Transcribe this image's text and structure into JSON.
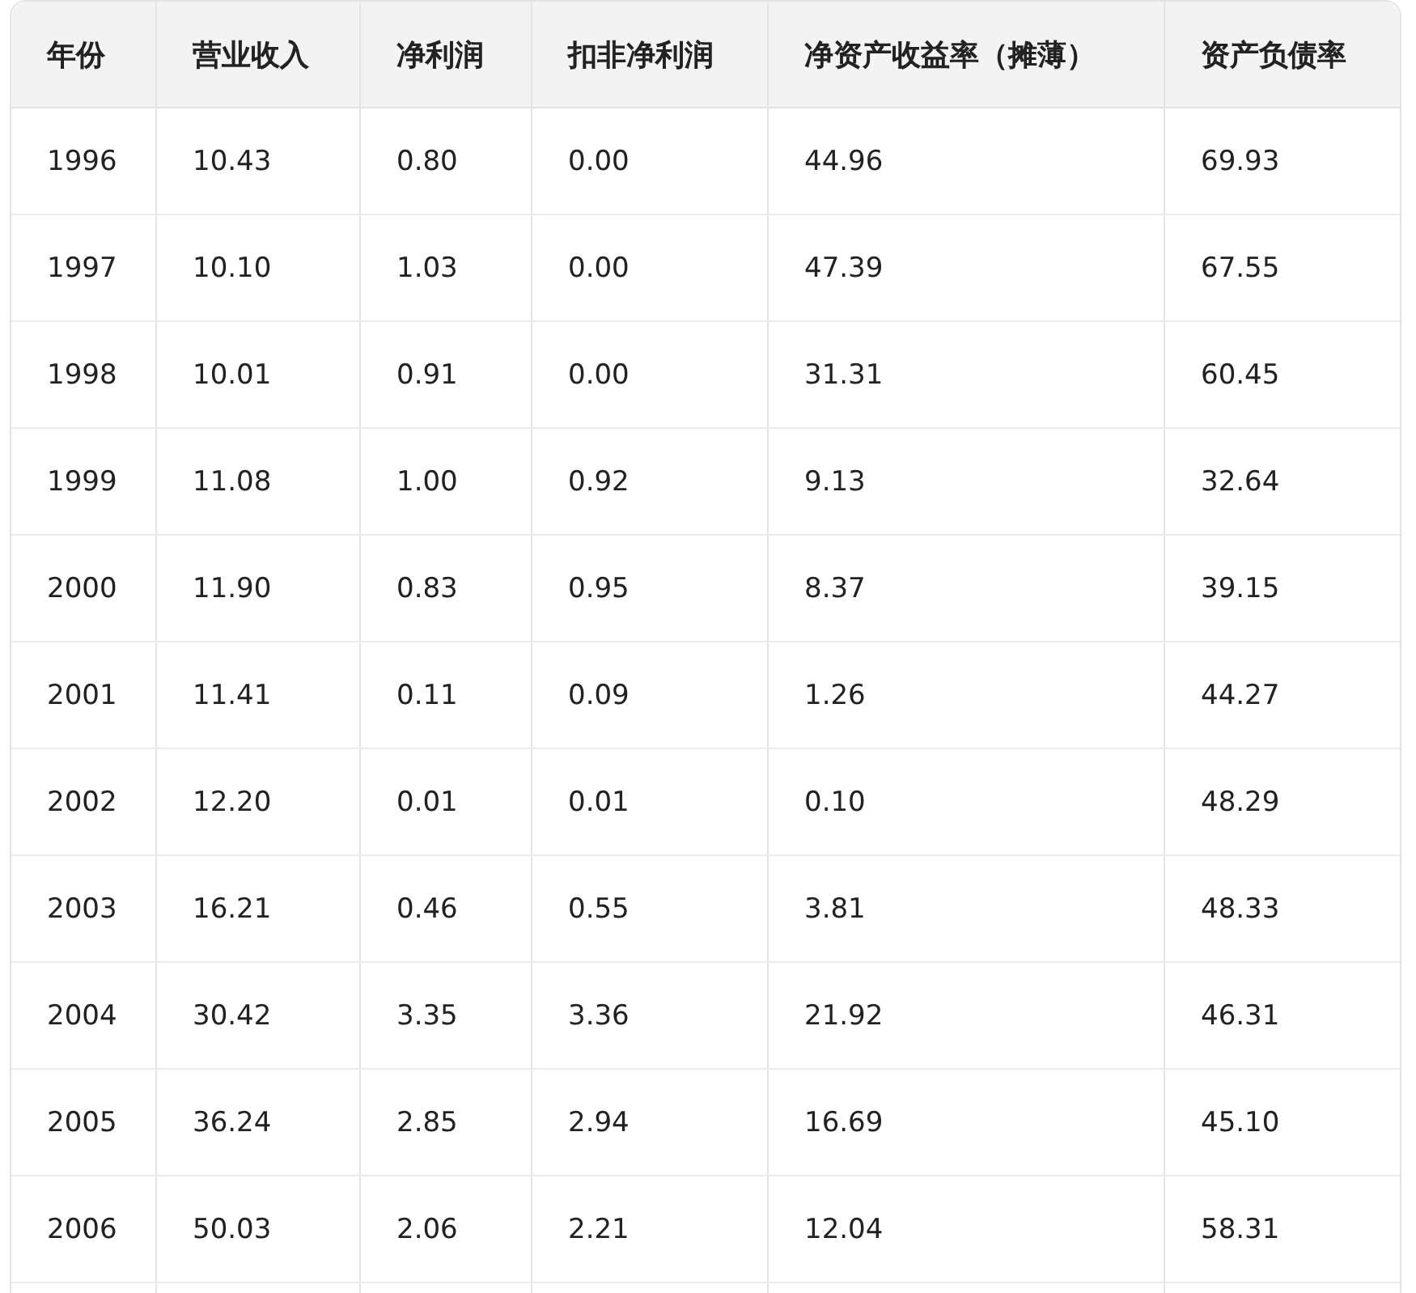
{
  "table": {
    "columns": [
      "年份",
      "营业收入",
      "净利润",
      "扣非净利润",
      "净资产收益率（摊薄）",
      "资产负债率"
    ],
    "rows": [
      [
        "1996",
        "10.43",
        "0.80",
        "0.00",
        "44.96",
        "69.93"
      ],
      [
        "1997",
        "10.10",
        "1.03",
        "0.00",
        "47.39",
        "67.55"
      ],
      [
        "1998",
        "10.01",
        "0.91",
        "0.00",
        "31.31",
        "60.45"
      ],
      [
        "1999",
        "11.08",
        "1.00",
        "0.92",
        "9.13",
        "32.64"
      ],
      [
        "2000",
        "11.90",
        "0.83",
        "0.95",
        "8.37",
        "39.15"
      ],
      [
        "2001",
        "11.41",
        "0.11",
        "0.09",
        "1.26",
        "44.27"
      ],
      [
        "2002",
        "12.20",
        "0.01",
        "0.01",
        "0.10",
        "48.29"
      ],
      [
        "2003",
        "16.21",
        "0.46",
        "0.55",
        "3.81",
        "48.33"
      ],
      [
        "2004",
        "30.42",
        "3.35",
        "3.36",
        "21.92",
        "46.31"
      ],
      [
        "2005",
        "36.24",
        "2.85",
        "2.94",
        "16.69",
        "45.10"
      ],
      [
        "2006",
        "50.03",
        "2.06",
        "2.21",
        "12.04",
        "58.31"
      ]
    ]
  }
}
